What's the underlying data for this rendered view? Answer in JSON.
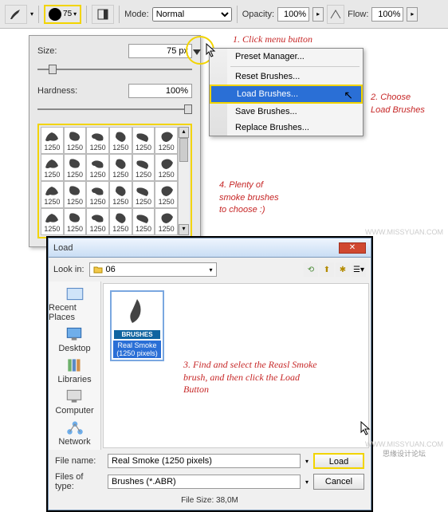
{
  "toolbar": {
    "brush_size_num": "75",
    "mode_label": "Mode:",
    "mode_value": "Normal",
    "opacity_label": "Opacity:",
    "opacity_value": "100%",
    "flow_label": "Flow:",
    "flow_value": "100%"
  },
  "panel": {
    "size_label": "Size:",
    "size_value": "75 px",
    "hardness_label": "Hardness:",
    "hardness_value": "100%"
  },
  "brush_cell_label": "1250",
  "menu": {
    "preset_manager": "Preset Manager...",
    "reset": "Reset Brushes...",
    "load": "Load Brushes...",
    "save": "Save Brushes...",
    "replace": "Replace Brushes..."
  },
  "ann": {
    "step1": "1. Click menu button",
    "step2a": "2. Choose",
    "step2b": "Load Brushes",
    "step3": "3. Find and select the Reasl Smoke brush, and then click the Load Button",
    "step4a": "4. Plenty of",
    "step4b": "smoke brushes",
    "step4c": "to choose :)"
  },
  "dlg": {
    "title": "Load",
    "lookin_label": "Look in:",
    "lookin_value": "06",
    "thumb_badge": "BRUSHES",
    "thumb_label": "Real Smoke (1250 pixels)",
    "filename_label": "File name:",
    "filename_value": "Real Smoke (1250 pixels)",
    "filetype_label": "Files of type:",
    "filetype_value": "Brushes (*.ABR)",
    "load_btn": "Load",
    "cancel_btn": "Cancel",
    "filesize_label": "File Size: 38,0M"
  },
  "places": {
    "recent": "Recent Places",
    "desktop": "Desktop",
    "libraries": "Libraries",
    "computer": "Computer",
    "network": "Network"
  },
  "watermark": {
    "url": "WWW.MISSYUAN.COM",
    "cn": "思缘设计论坛"
  }
}
